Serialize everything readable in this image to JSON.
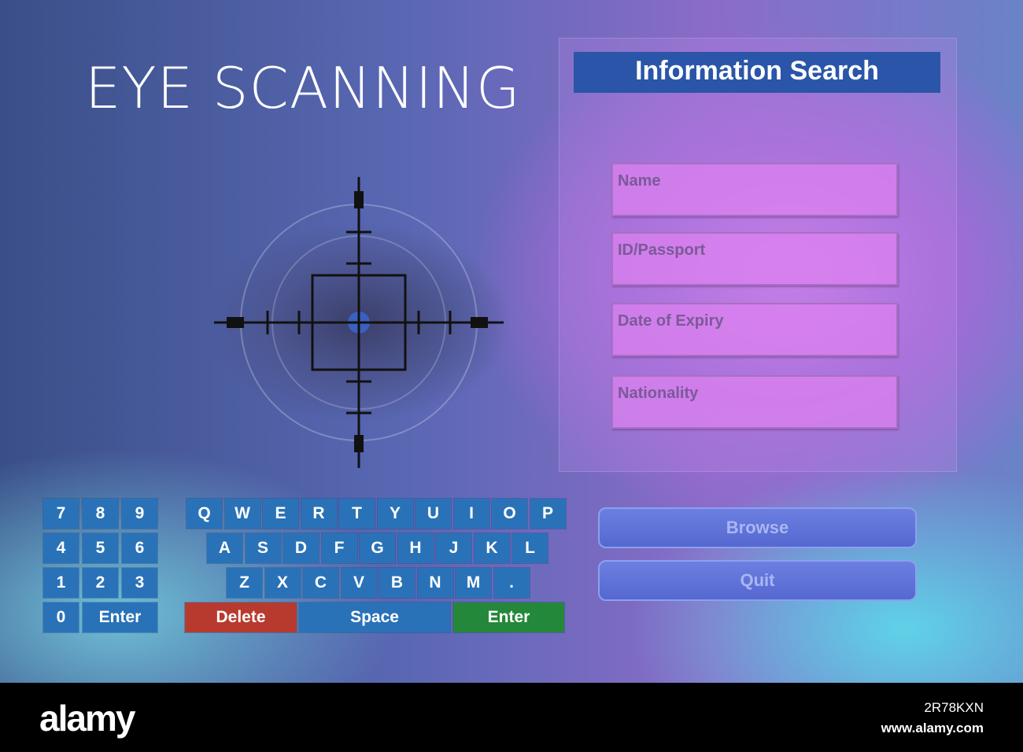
{
  "title": "EYE SCANNING",
  "panel": {
    "header": "Information Search",
    "fields": [
      "Name",
      "ID/Passport",
      "Date of Expiry",
      "Nationality"
    ],
    "buttons": {
      "browse": "Browse",
      "quit": "Quit"
    }
  },
  "numpad": {
    "keys": [
      "7",
      "8",
      "9",
      "4",
      "5",
      "6",
      "1",
      "2",
      "3",
      "0"
    ],
    "enter": "Enter"
  },
  "keyboard": {
    "row1": [
      "Q",
      "W",
      "E",
      "R",
      "T",
      "Y",
      "U",
      "I",
      "O",
      "P"
    ],
    "row2": [
      "A",
      "S",
      "D",
      "F",
      "G",
      "H",
      "J",
      "K",
      "L"
    ],
    "row3": [
      "Z",
      "X",
      "C",
      "V",
      "B",
      "N",
      "M",
      "."
    ],
    "delete": "Delete",
    "space": "Space",
    "enter": "Enter"
  },
  "colors": {
    "key": "#2a72b8",
    "delete": "#b83a2e",
    "enter": "#24883a"
  },
  "footer": {
    "logo": "alamy",
    "image_id": "2R78KXN",
    "site": "www.alamy.com"
  }
}
